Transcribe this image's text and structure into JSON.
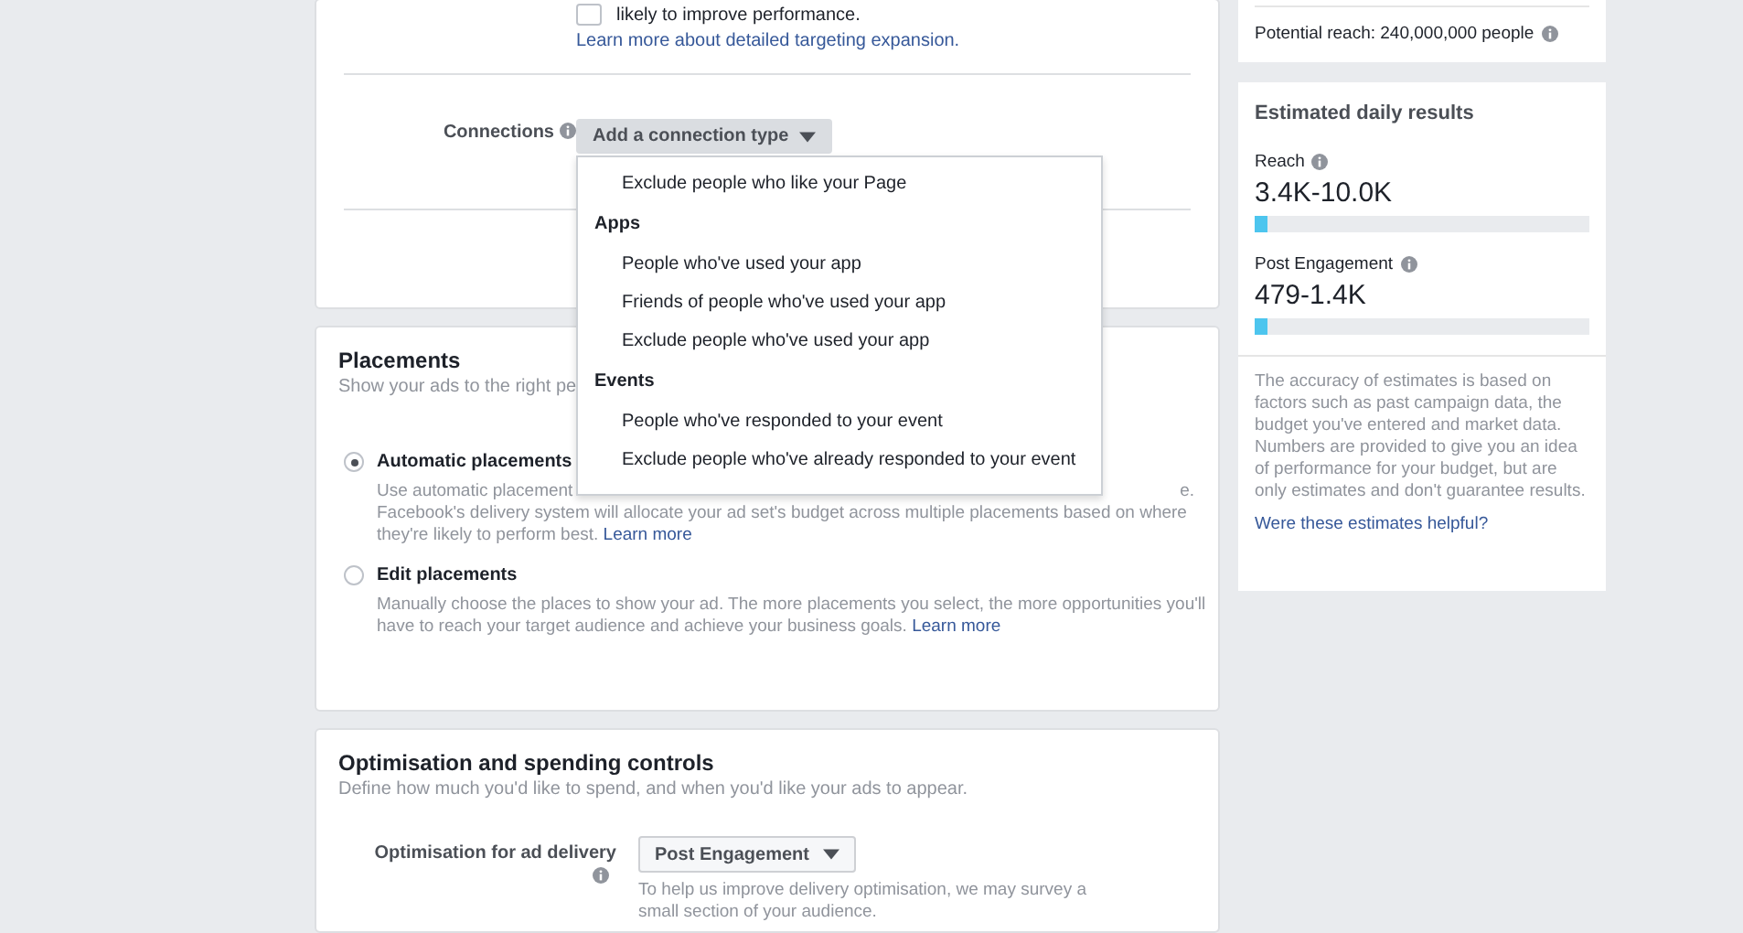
{
  "targeting": {
    "expansion_checkbox": {
      "checked": false,
      "label": "likely to improve performance."
    },
    "learn_more_link": "Learn more about detailed targeting expansion.",
    "connections": {
      "label": "Connections",
      "button": "Add a connection type",
      "menu": [
        {
          "kind": "option",
          "label": "Exclude people who like your Page"
        },
        {
          "kind": "heading",
          "label": "Apps"
        },
        {
          "kind": "option",
          "label": "People who've used your app"
        },
        {
          "kind": "option",
          "label": "Friends of people who've used your app"
        },
        {
          "kind": "option",
          "label": "Exclude people who've used your app"
        },
        {
          "kind": "heading",
          "label": "Events"
        },
        {
          "kind": "option",
          "label": "People who've responded to your event"
        },
        {
          "kind": "option",
          "label": "Exclude people who've already responded to your event"
        }
      ]
    }
  },
  "placements": {
    "title": "Placements",
    "subtitle": "Show your ads to the right pe",
    "options": [
      {
        "label": "Automatic placements",
        "selected": true,
        "description": "Use automatic placement",
        "description_2": "e.",
        "description_3": "Facebook's delivery system will allocate your ad set's budget across multiple placements based on where they're likely to perform best.",
        "link": "Learn more"
      },
      {
        "label": "Edit placements",
        "selected": false,
        "description": "Manually choose the places to show your ad. The more placements you select, the more opportunities you'll have to reach your target audience and achieve your business goals.",
        "link": "Learn more"
      }
    ]
  },
  "optimisation": {
    "title": "Optimisation and spending controls",
    "subtitle": "Define how much you'd like to spend, and when you'd like your ads to appear.",
    "field_label": "Optimisation for ad delivery",
    "dropdown": "Post Engagement",
    "help": "To help us improve delivery optimisation, we may survey a small section of your audience."
  },
  "audience": {
    "potential_reach": "Potential reach: 240,000,000 people"
  },
  "estimates": {
    "title": "Estimated daily results",
    "metrics": [
      {
        "label": "Reach",
        "value": "3.4K-10.0K",
        "level": 0.04
      },
      {
        "label": "Post Engagement",
        "value": "479-1.4K",
        "level": 0.04
      }
    ],
    "note": "The accuracy of estimates is based on factors such as past campaign data, the budget you've entered and market data. Numbers are provided to give you an idea of performance for your budget, but are only estimates and don't guarantee results.",
    "feedback_link": "Were these estimates helpful?"
  }
}
